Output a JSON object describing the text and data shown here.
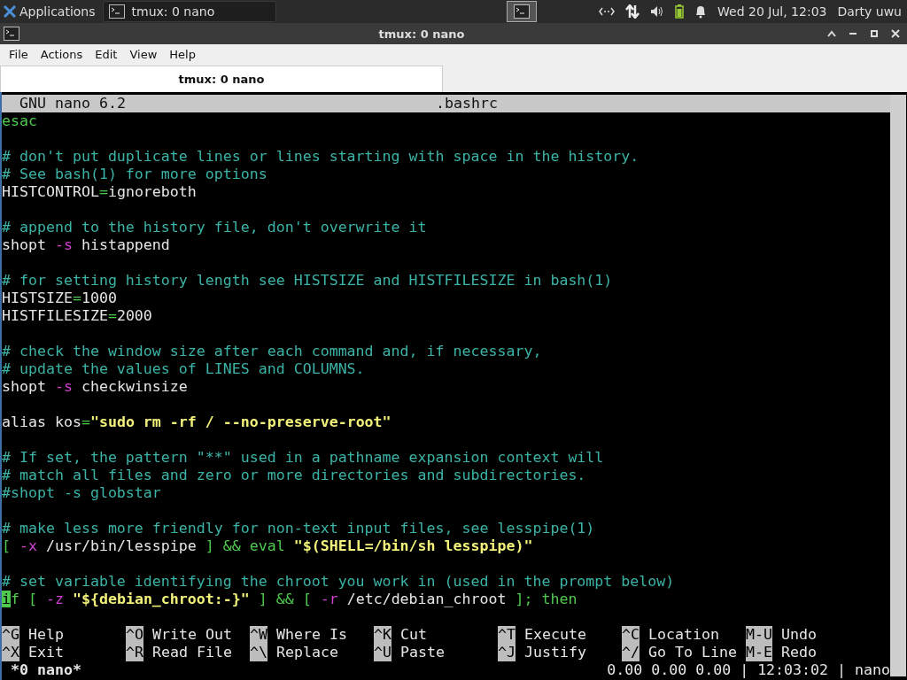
{
  "panel": {
    "apps_label": "Applications",
    "tasks": [
      {
        "label": "tmux: 0 nano",
        "selected": false
      }
    ],
    "clock": "Wed 20 Jul, 12:03",
    "user": "Darty uwu"
  },
  "window": {
    "title": "tmux: 0 nano"
  },
  "menu": [
    "File",
    "Actions",
    "Edit",
    "View",
    "Help"
  ],
  "tabs": [
    {
      "label": "tmux: 0 nano",
      "selected": true
    }
  ],
  "nano": {
    "version": "GNU nano 6.2",
    "filename": ".bashrc",
    "lines": [
      {
        "kind": "code",
        "segments": [
          {
            "text": "esac",
            "kind": "keyword"
          }
        ]
      },
      {
        "kind": "blank"
      },
      {
        "kind": "code",
        "segments": [
          {
            "text": "# don't put duplicate lines or lines starting with space in the history.",
            "kind": "comment"
          }
        ]
      },
      {
        "kind": "code",
        "segments": [
          {
            "text": "# See bash(1) for more options",
            "kind": "comment"
          }
        ]
      },
      {
        "kind": "code",
        "segments": [
          {
            "text": "HISTCONTROL",
            "kind": "plain"
          },
          {
            "text": "=",
            "kind": "keyword"
          },
          {
            "text": "ignoreboth",
            "kind": "plain"
          }
        ]
      },
      {
        "kind": "blank"
      },
      {
        "kind": "code",
        "segments": [
          {
            "text": "# append to the history file, don't overwrite it",
            "kind": "comment"
          }
        ]
      },
      {
        "kind": "code",
        "segments": [
          {
            "text": "shopt ",
            "kind": "plain"
          },
          {
            "text": "-s",
            "kind": "flag"
          },
          {
            "text": " histappend",
            "kind": "plain"
          }
        ]
      },
      {
        "kind": "blank"
      },
      {
        "kind": "code",
        "segments": [
          {
            "text": "# for setting history length see HISTSIZE and HISTFILESIZE in bash(1)",
            "kind": "comment"
          }
        ]
      },
      {
        "kind": "code",
        "segments": [
          {
            "text": "HISTSIZE",
            "kind": "plain"
          },
          {
            "text": "=",
            "kind": "keyword"
          },
          {
            "text": "1000",
            "kind": "plain"
          }
        ]
      },
      {
        "kind": "code",
        "segments": [
          {
            "text": "HISTFILESIZE",
            "kind": "plain"
          },
          {
            "text": "=",
            "kind": "keyword"
          },
          {
            "text": "2000",
            "kind": "plain"
          }
        ]
      },
      {
        "kind": "blank"
      },
      {
        "kind": "code",
        "segments": [
          {
            "text": "# check the window size after each command and, if necessary,",
            "kind": "comment"
          }
        ]
      },
      {
        "kind": "code",
        "segments": [
          {
            "text": "# update the values of LINES and COLUMNS.",
            "kind": "comment"
          }
        ]
      },
      {
        "kind": "code",
        "segments": [
          {
            "text": "shopt ",
            "kind": "plain"
          },
          {
            "text": "-s",
            "kind": "flag"
          },
          {
            "text": " checkwinsize",
            "kind": "plain"
          }
        ]
      },
      {
        "kind": "blank"
      },
      {
        "kind": "code",
        "segments": [
          {
            "text": "alias kos",
            "kind": "plain"
          },
          {
            "text": "=",
            "kind": "keyword"
          },
          {
            "text": "\"sudo rm -rf / --no-preserve-root\"",
            "kind": "string"
          }
        ]
      },
      {
        "kind": "blank"
      },
      {
        "kind": "code",
        "segments": [
          {
            "text": "# If set, the pattern \"**\" used in a pathname expansion context will",
            "kind": "comment"
          }
        ]
      },
      {
        "kind": "code",
        "segments": [
          {
            "text": "# match all files and zero or more directories and subdirectories.",
            "kind": "comment"
          }
        ]
      },
      {
        "kind": "code",
        "segments": [
          {
            "text": "#shopt -s globstar",
            "kind": "comment"
          }
        ]
      },
      {
        "kind": "blank"
      },
      {
        "kind": "code",
        "segments": [
          {
            "text": "# make less more friendly for non-text input files, see lesspipe(1)",
            "kind": "comment"
          }
        ]
      },
      {
        "kind": "code",
        "segments": [
          {
            "text": "[ ",
            "kind": "keyword"
          },
          {
            "text": "-x",
            "kind": "flag"
          },
          {
            "text": " /usr/bin/lesspipe ",
            "kind": "plain"
          },
          {
            "text": "] && eval ",
            "kind": "keyword"
          },
          {
            "text": "\"$(SHELL=/bin/sh lesspipe)\"",
            "kind": "string"
          }
        ]
      },
      {
        "kind": "blank"
      },
      {
        "kind": "code",
        "segments": [
          {
            "text": "# set variable identifying the chroot you work in (used in the prompt below)",
            "kind": "comment"
          }
        ]
      },
      {
        "kind": "code",
        "segments": [
          {
            "text": "i",
            "kind": "cursor"
          },
          {
            "text": "f [ ",
            "kind": "keyword"
          },
          {
            "text": "-z ",
            "kind": "flag"
          },
          {
            "text": "\"${debian_chroot:-}\"",
            "kind": "string"
          },
          {
            "text": " ] && [ ",
            "kind": "keyword"
          },
          {
            "text": "-r",
            "kind": "flag"
          },
          {
            "text": " /etc/debian_chroot ",
            "kind": "plain"
          },
          {
            "text": "]; then",
            "kind": "keyword"
          }
        ]
      }
    ],
    "shortcuts": [
      {
        "key": "^G",
        "label": "Help"
      },
      {
        "key": "^O",
        "label": "Write Out"
      },
      {
        "key": "^W",
        "label": "Where Is"
      },
      {
        "key": "^K",
        "label": "Cut"
      },
      {
        "key": "^T",
        "label": "Execute"
      },
      {
        "key": "^C",
        "label": "Location"
      },
      {
        "key": "M-U",
        "label": "Undo"
      },
      {
        "key": "^X",
        "label": "Exit"
      },
      {
        "key": "^R",
        "label": "Read File"
      },
      {
        "key": "^\\",
        "label": "Replace"
      },
      {
        "key": "^U",
        "label": "Paste"
      },
      {
        "key": "^J",
        "label": "Justify"
      },
      {
        "key": "^/",
        "label": "Go To Line"
      },
      {
        "key": "M-E",
        "label": "Redo"
      }
    ]
  },
  "tmux": {
    "window": "*0 nano*",
    "status": "0.00 0.00 0.00 | 12:03:02 | nano"
  }
}
